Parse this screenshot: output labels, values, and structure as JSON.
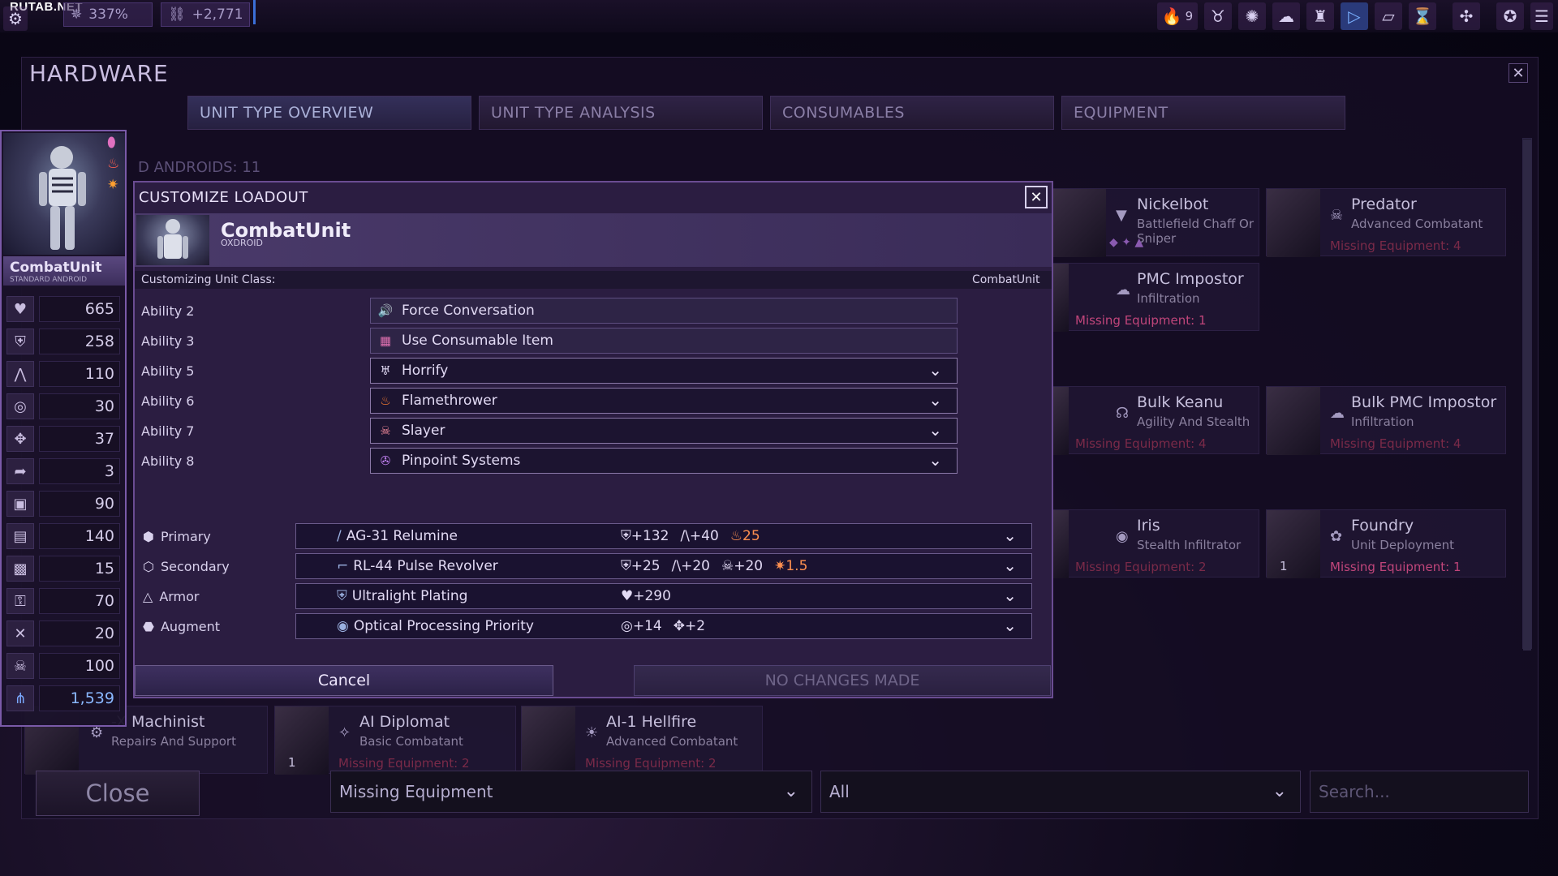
{
  "watermark": "RUTAB.NET",
  "topbar": {
    "stat1": "337%",
    "stat2": "+2,771",
    "alert_count": "9",
    "icons": [
      "gear-icon",
      "influence-icon",
      "link-icon",
      "alert-icon",
      "horns-icon",
      "cog-icon",
      "cloud-icon",
      "factory-icon",
      "play-icon",
      "card-icon",
      "hourglass-icon",
      "gamepad-icon",
      "emblem-icon",
      "menu-icon"
    ]
  },
  "panel": {
    "title": "HARDWARE",
    "close": "✕"
  },
  "tabs": [
    "UNIT TYPE OVERVIEW",
    "UNIT TYPE ANALYSIS",
    "CONSUMABLES",
    "EQUIPMENT"
  ],
  "section_label": "D ANDROIDS: 11",
  "unit_card": {
    "name": "CombatUnit",
    "subtitle": "STANDARD ANDROID",
    "stats": [
      {
        "icon": "heart-icon",
        "value": "665"
      },
      {
        "icon": "armor-icon",
        "value": "258"
      },
      {
        "icon": "speed-icon",
        "value": "110"
      },
      {
        "icon": "target-icon",
        "value": "30"
      },
      {
        "icon": "move-icon",
        "value": "37"
      },
      {
        "icon": "dash-icon",
        "value": "3"
      },
      {
        "icon": "capsule-icon",
        "value": "90"
      },
      {
        "icon": "book-icon",
        "value": "140"
      },
      {
        "icon": "chip-icon",
        "value": "15"
      },
      {
        "icon": "lock-icon",
        "value": "70"
      },
      {
        "icon": "tools-icon",
        "value": "20"
      },
      {
        "icon": "skull-icon",
        "value": "100"
      },
      {
        "icon": "power-icon",
        "value": "1,539"
      }
    ]
  },
  "modal": {
    "title": "CUSTOMIZE LOADOUT",
    "close": "✕",
    "unit_name": "CombatUnit",
    "unit_sub": "OXDROID",
    "customizing_label": "Customizing Unit Class:",
    "customizing_value": "CombatUnit",
    "abilities": [
      {
        "label": "Ability 2",
        "name": "Force Conversation",
        "icon": "🔊",
        "dropdown": false
      },
      {
        "label": "Ability 3",
        "name": "Use Consumable Item",
        "icon": "▦",
        "dropdown": false
      },
      {
        "label": "Ability 5",
        "name": "Horrify",
        "icon": "♅",
        "dropdown": true
      },
      {
        "label": "Ability 6",
        "name": "Flamethrower",
        "icon": "♨",
        "dropdown": true
      },
      {
        "label": "Ability 7",
        "name": "Slayer",
        "icon": "☠",
        "dropdown": true
      },
      {
        "label": "Ability 8",
        "name": "Pinpoint Systems",
        "icon": "✇",
        "dropdown": true
      }
    ],
    "equipment": [
      {
        "slot": "Primary",
        "slot_icon": "⬢",
        "name": "AG-31 Relumine",
        "icon": "/",
        "stats": [
          "⛨+132",
          "/\\+40",
          "♨25"
        ]
      },
      {
        "slot": "Secondary",
        "slot_icon": "⬡",
        "name": "RL-44 Pulse Revolver",
        "icon": "⌐",
        "stats": [
          "⛨+25",
          "/\\+20",
          "☠+20",
          "✷1.5"
        ]
      },
      {
        "slot": "Armor",
        "slot_icon": "△",
        "name": "Ultralight Plating",
        "icon": "⛨",
        "stats": [
          "♥+290"
        ]
      },
      {
        "slot": "Augment",
        "slot_icon": "⬣",
        "name": "Optical Processing Priority",
        "icon": "◉",
        "stats": [
          "◎+14",
          "✥+2"
        ]
      }
    ],
    "cancel_label": "Cancel",
    "confirm_label": "NO CHANGES MADE"
  },
  "unit_cards": [
    {
      "name": "Nickelbot",
      "sub": "Battlefield Chaff Or Sniper",
      "miss": "",
      "icon": "▼"
    },
    {
      "name": "Predator",
      "sub": "Advanced Combatant",
      "miss": "Missing Equipment: 4",
      "icon": "☠"
    },
    {
      "name": "PMC Impostor",
      "sub": "Infiltration",
      "miss": "Missing Equipment: 1",
      "icon": "☁"
    },
    {
      "name": "Bulk Keanu",
      "sub": "Agility And Stealth",
      "miss": "Missing Equipment: 4",
      "icon": "☊"
    },
    {
      "name": "Bulk PMC Impostor",
      "sub": "Infiltration",
      "miss": "Missing Equipment: 4",
      "icon": "☁"
    },
    {
      "name": "Iris",
      "sub": "Stealth Infiltrator",
      "miss": "Missing Equipment: 2",
      "icon": "◉"
    },
    {
      "name": "Foundry",
      "sub": "Unit Deployment",
      "miss": "Missing Equipment: 1",
      "icon": "✿",
      "num": "1"
    },
    {
      "name": "-X Machinist",
      "sub": "Repairs And Support",
      "miss": "",
      "icon": "⚙"
    },
    {
      "name": "AI Diplomat",
      "sub": "Basic Combatant",
      "miss": "Missing Equipment: 2",
      "icon": "✧",
      "num": "1"
    },
    {
      "name": "AI-1 Hellfire",
      "sub": "Advanced Combatant",
      "miss": "Missing Equipment: 2",
      "icon": "☀"
    }
  ],
  "bottom": {
    "close_label": "Close",
    "filter1": "Missing Equipment",
    "filter2": "All",
    "search_placeholder": "Search..."
  }
}
